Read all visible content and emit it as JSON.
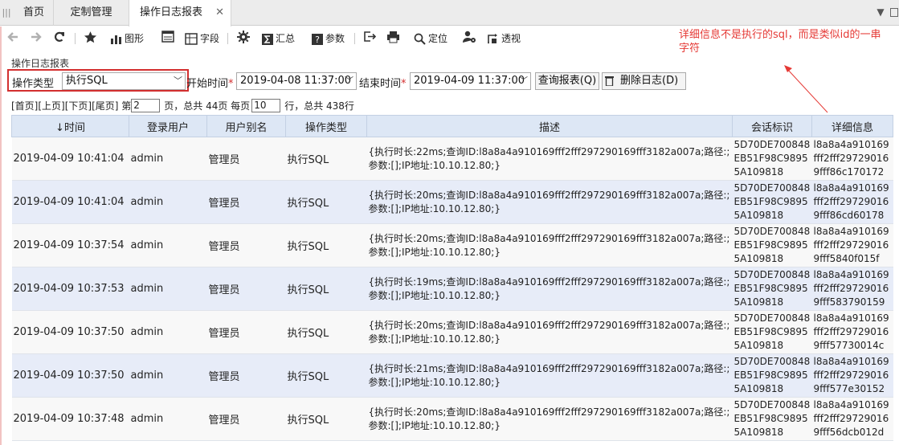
{
  "tabs": {
    "items": [
      "首页",
      "定制管理",
      "操作日志报表"
    ],
    "close_glyph": "✕",
    "menu_glyph": "▼"
  },
  "toolbar": {
    "chart": "图形",
    "field": "字段",
    "summary": "汇总",
    "param": "参数",
    "locate": "定位",
    "pivot": "透视"
  },
  "annotation": {
    "text": "详细信息不是执行的sql，而是类似id的一串字符",
    "color": "#e53935"
  },
  "report": {
    "title": "操作日志报表"
  },
  "filter": {
    "op_type_label": "操作类型",
    "op_type_value": "执行SQL",
    "start_label": "开始时间",
    "start_value": "2019-04-08 11:37:00",
    "end_label": "结束时间",
    "end_value": "2019-04-09 11:37:00",
    "required_mark": "*",
    "query_button": "查询报表(Q)",
    "delete_button": "删除日志(D)"
  },
  "pager": {
    "nav": "[首页][上页][下页][尾页] 第",
    "page": "2",
    "text1": "页，总共 44页 每页",
    "page_size": "10",
    "text2": "行，总共 438行"
  },
  "table": {
    "columns": [
      "时间",
      "登录用户",
      "用户别名",
      "操作类型",
      "描述",
      "会话标识",
      "详细信息"
    ],
    "sort_glyph": "↓",
    "rows": [
      {
        "time": "2019-04-09  10:41:04",
        "user": "admin",
        "alias": "管理员",
        "type": "执行SQL",
        "desc": "{执行时长:22ms;查询ID:l8a8a4a910169fff2fff297290169fff3182a007a;路径:;参数:[];IP地址:10.10.12.80;}",
        "session": "5D70DE700848EB51F98C98955A109818",
        "detail": "l8a8a4a910169fff2fff297290169fff86c170172"
      },
      {
        "time": "2019-04-09  10:41:04",
        "user": "admin",
        "alias": "管理员",
        "type": "执行SQL",
        "desc": "{执行时长:20ms;查询ID:l8a8a4a910169fff2fff297290169fff3182a007a;路径:;参数:[];IP地址:10.10.12.80;}",
        "session": "5D70DE700848EB51F98C98955A109818",
        "detail": "l8a8a4a910169fff2fff297290169fff86cd60178"
      },
      {
        "time": "2019-04-09  10:37:54",
        "user": "admin",
        "alias": "管理员",
        "type": "执行SQL",
        "desc": "{执行时长:20ms;查询ID:l8a8a4a910169fff2fff297290169fff3182a007a;路径:;参数:[];IP地址:10.10.12.80;}",
        "session": "5D70DE700848EB51F98C98955A109818",
        "detail": "l8a8a4a910169fff2fff297290169fff5840f015f"
      },
      {
        "time": "2019-04-09  10:37:53",
        "user": "admin",
        "alias": "管理员",
        "type": "执行SQL",
        "desc": "{执行时长:19ms;查询ID:l8a8a4a910169fff2fff297290169fff3182a007a;路径:;参数:[];IP地址:10.10.12.80;}",
        "session": "5D70DE700848EB51F98C98955A109818",
        "detail": "l8a8a4a910169fff2fff297290169fff583790159"
      },
      {
        "time": "2019-04-09  10:37:50",
        "user": "admin",
        "alias": "管理员",
        "type": "执行SQL",
        "desc": "{执行时长:20ms;查询ID:l8a8a4a910169fff2fff297290169fff3182a007a;路径:;参数:[];IP地址:10.10.12.80;}",
        "session": "5D70DE700848EB51F98C98955A109818",
        "detail": "l8a8a4a910169fff2fff297290169fff57730014c"
      },
      {
        "time": "2019-04-09  10:37:50",
        "user": "admin",
        "alias": "管理员",
        "type": "执行SQL",
        "desc": "{执行时长:21ms;查询ID:l8a8a4a910169fff2fff297290169fff3182a007a;路径:;参数:[];IP地址:10.10.12.80;}",
        "session": "5D70DE700848EB51F98C98955A109818",
        "detail": "l8a8a4a910169fff2fff297290169fff577e30152"
      },
      {
        "time": "2019-04-09  10:37:48",
        "user": "admin",
        "alias": "管理员",
        "type": "执行SQL",
        "desc": "{执行时长:20ms;查询ID:l8a8a4a910169fff2fff297290169fff3182a007a;路径:;参数:[];IP地址:10.10.12.80;}",
        "session": "5D70DE700848EB51F98C98955A109818",
        "detail": "l8a8a4a910169fff2fff297290169fff56dcb012d"
      }
    ]
  }
}
